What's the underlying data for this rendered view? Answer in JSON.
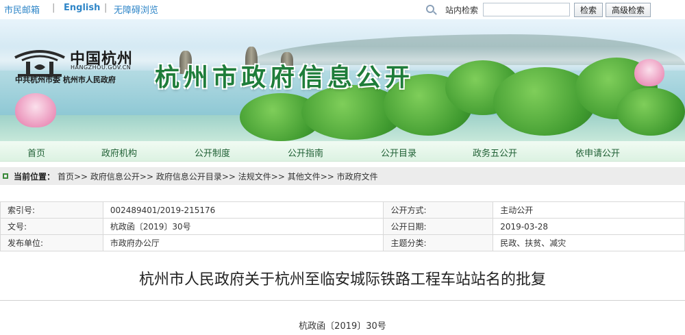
{
  "topbar": {
    "links": [
      "市民邮箱",
      "English",
      "无障碍浏览"
    ],
    "separator": "|",
    "search_label": "站内检索",
    "search_value": "",
    "search_button": "检索",
    "advanced_search_button": "高级检索"
  },
  "banner": {
    "logo_title": "中国杭州",
    "logo_domain": "HANGZHOU.GOV.CN",
    "logo_org": "中共杭州市委   杭州市人民政府",
    "site_title": "杭州市政府信息公开"
  },
  "nav": {
    "items": [
      "首页",
      "政府机构",
      "公开制度",
      "公开指南",
      "公开目录",
      "政务五公开",
      "依申请公开"
    ]
  },
  "breadcrumb": {
    "label": "当前位置：",
    "path": "首页>> 政府信息公开>> 政府信息公开目录>> 法规文件>> 其他文件>> 市政府文件"
  },
  "info": {
    "rows": [
      {
        "k1": "索引号:",
        "v1": "002489401/2019-215176",
        "k2": "公开方式:",
        "v2": "主动公开"
      },
      {
        "k1": "文号:",
        "v1": "杭政函〔2019〕30号",
        "k2": "公开日期:",
        "v2": "2019-03-28"
      },
      {
        "k1": "发布单位:",
        "v1": "市政府办公厅",
        "k2": "主题分类:",
        "v2": "民政、扶贫、减灾"
      }
    ]
  },
  "document": {
    "title": "杭州市人民政府关于杭州至临安城际铁路工程车站站名的批复",
    "number": "杭政函〔2019〕30号"
  },
  "colors": {
    "link_blue": "#2f86c8",
    "title_green": "#1f7d3a",
    "nav_text": "#1e5f33"
  }
}
